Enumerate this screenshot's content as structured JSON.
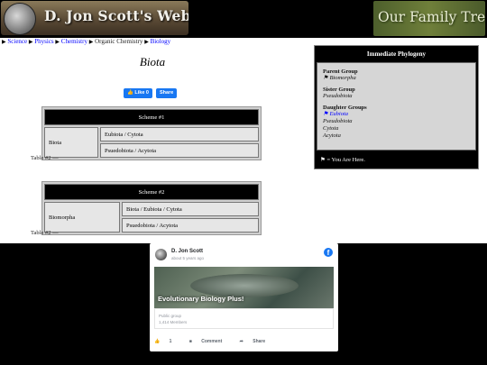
{
  "header": {
    "site_title": "D. Jon Scott's Website",
    "family_tree_label": "Our Family Tree"
  },
  "breadcrumb": {
    "items": [
      {
        "label": "Science",
        "link": true
      },
      {
        "label": "Physics",
        "link": true
      },
      {
        "label": "Chemistry",
        "link": true
      },
      {
        "label": "Organic Chemistry",
        "link": false
      },
      {
        "label": "Biology",
        "link": true
      }
    ]
  },
  "page": {
    "title": "Biota"
  },
  "social_buttons": {
    "like_label": "Like 0",
    "share_label": "Share"
  },
  "scheme1": {
    "header": "Scheme #1",
    "group": "Biota",
    "rows": [
      "Eubiota / Cytota",
      "Psuedobiota / Acytota"
    ],
    "caption": "Table #2 —"
  },
  "scheme2": {
    "header": "Scheme #2",
    "group": "Biomorpha",
    "rows": [
      "Biota / Eubiota / Cytota",
      "Psuedobiota / Acytota"
    ],
    "caption": "Table #2 —"
  },
  "phylogeny": {
    "title": "Immediate Phylogeny",
    "parent_label": "Parent Group",
    "parent_value": "⚑ Biomorpha",
    "sister_label": "Sister Group",
    "sister_value": "Pseudobiota",
    "daughter_label": "Daughter Groups",
    "daughters": [
      "⚑ Eubiota",
      "Pseudobiota",
      "Cytota",
      "Acytota"
    ],
    "legend": "⚑ = You Are Here."
  },
  "fb_card": {
    "author": "D. Jon Scott",
    "time": "about 5 years ago",
    "image_caption": "Evolutionary Biology Plus!",
    "group_type": "Public group",
    "members": "1,414 Members",
    "like_count": "1",
    "comment_label": "Comment",
    "share_label": "Share"
  },
  "colors": {
    "link": "#0000ff",
    "facebook_blue": "#1877f2",
    "header_bg": "#000000"
  }
}
